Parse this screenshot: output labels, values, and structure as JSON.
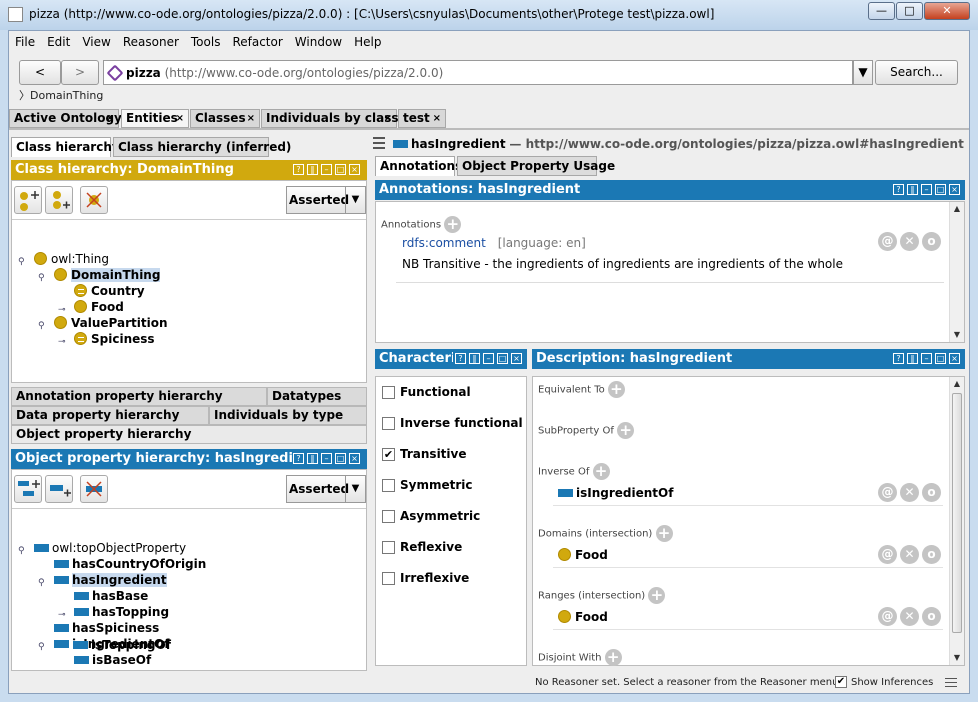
{
  "window": {
    "title": "pizza (http://www.co-ode.org/ontologies/pizza/2.0.0)  : [C:\\Users\\csnyulas\\Documents\\other\\Protege test\\pizza.owl]",
    "minimize": "—",
    "maximize": "□",
    "close": "✕"
  },
  "menu": [
    "File",
    "Edit",
    "View",
    "Reasoner",
    "Tools",
    "Refactor",
    "Window",
    "Help"
  ],
  "nav": {
    "back": "<",
    "forward": ">",
    "ontology_name": "pizza",
    "ontology_iri": "(http://www.co-ode.org/ontologies/pizza/2.0.0)",
    "search": "Search...",
    "breadcrumb": "DomainThing"
  },
  "tabs": [
    "Active Ontology",
    "Entities",
    "Classes",
    "Individuals by class",
    "test"
  ],
  "tab_close": "×",
  "class_view": {
    "subtabs": [
      "Class hierarchy",
      "Class hierarchy (inferred)"
    ],
    "header": "Class hierarchy: DomainThing",
    "combo": "Asserted",
    "nodes": [
      "owl:Thing",
      "DomainThing",
      "Country",
      "Food",
      "ValuePartition",
      "Spiciness"
    ]
  },
  "list_tabs": [
    "Annotation property hierarchy",
    "Datatypes",
    "Data property hierarchy",
    "Individuals by type",
    "Object property hierarchy"
  ],
  "prop_view": {
    "header": "Object property hierarchy: hasIngredient",
    "combo": "Asserted",
    "nodes": [
      "owl:topObjectProperty",
      "hasCountryOfOrigin",
      "hasIngredient",
      "hasBase",
      "hasTopping",
      "hasSpiciness",
      "isIngredientOf",
      "isBaseOf",
      "isToppingOf"
    ]
  },
  "entity": {
    "name": "hasIngredient",
    "iri": "— http://www.co-ode.org/ontologies/pizza/pizza.owl#hasIngredient"
  },
  "right_subtabs": [
    "Annotations",
    "Object Property Usage"
  ],
  "annotations": {
    "header": "Annotations: hasIngredient",
    "label": "Annotations",
    "property": "rdfs:comment",
    "lang": "[language: en]",
    "value": "NB Transitive - the ingredients of ingredients are ingredients of the whole"
  },
  "characteristics": {
    "header": "Characteri",
    "items": [
      {
        "label": "Functional",
        "checked": false
      },
      {
        "label": "Inverse functional",
        "checked": false
      },
      {
        "label": "Transitive",
        "checked": true
      },
      {
        "label": "Symmetric",
        "checked": false
      },
      {
        "label": "Asymmetric",
        "checked": false
      },
      {
        "label": "Reflexive",
        "checked": false
      },
      {
        "label": "Irreflexive",
        "checked": false
      }
    ],
    "check_mark": "✔"
  },
  "description": {
    "header": "Description: hasIngredient",
    "sections": [
      "Equivalent To",
      "SubProperty Of",
      "Inverse Of",
      "Domains (intersection)",
      "Ranges (intersection)",
      "Disjoint With"
    ],
    "inverse_value": "isIngredientOf",
    "domain_value": "Food",
    "range_value": "Food"
  },
  "row_icons": {
    "annotate": "@",
    "delete": "✕",
    "edit": "o"
  },
  "add_symbol": "+",
  "status": {
    "reasoner": "No Reasoner set. Select a reasoner from the Reasoner menu",
    "show_inferences": "Show Inferences",
    "show_inferences_checked": true,
    "check_mark": "✔"
  },
  "colors": {
    "class_gold": "#d1a90e",
    "property_blue": "#1b78b4",
    "selection": "#c7d9ee"
  }
}
